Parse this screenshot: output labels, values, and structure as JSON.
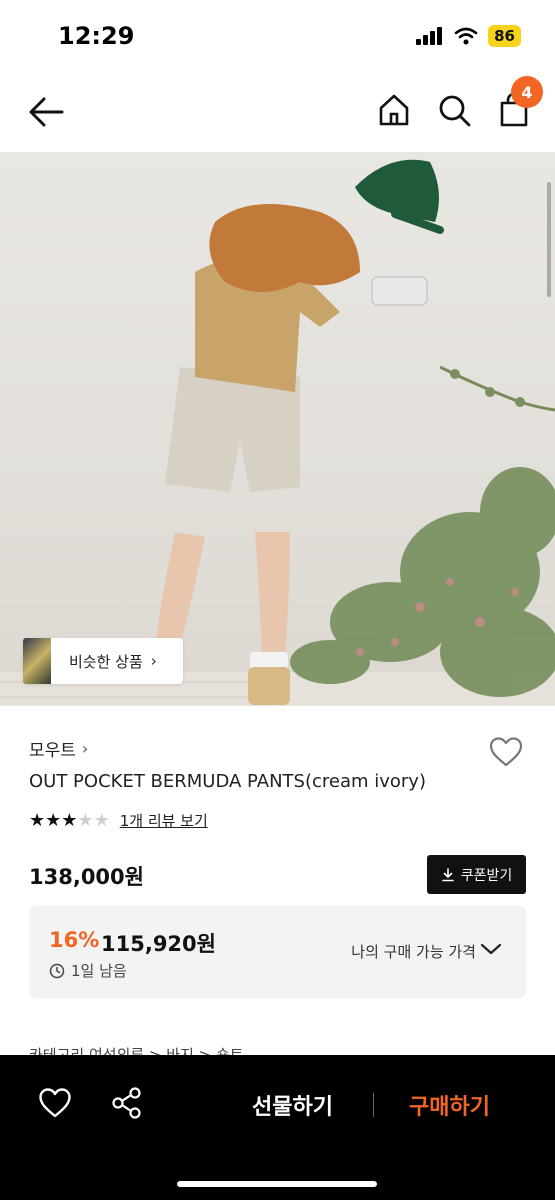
{
  "status": {
    "time": "12:29",
    "battery": "86"
  },
  "nav": {
    "cart_count": "4"
  },
  "image": {
    "similar_label": "비슷한 상품",
    "similar_chevron": "›"
  },
  "product": {
    "brand": "모우트",
    "brand_chevron": "›",
    "title": "OUT POCKET BERMUDA PANTS(cream ivory)",
    "rating": 3,
    "rating_max": 5,
    "review_link": "1개 리뷰 보기",
    "price": "138,000원",
    "coupon_label": "쿠폰받기"
  },
  "discount": {
    "percent": "16%",
    "price": "115,920원",
    "time_left": "1일 남음",
    "my_price_label": "나의 구매 가능 가격"
  },
  "category": {
    "text": "카테고리      여성의류 > 바지 > 숏트"
  },
  "bottom_bar": {
    "gift_label": "선물하기",
    "buy_label": "구매하기"
  },
  "colors": {
    "accent": "#f26522",
    "battery": "#f7d31b",
    "bottom_bar": "#000000"
  }
}
